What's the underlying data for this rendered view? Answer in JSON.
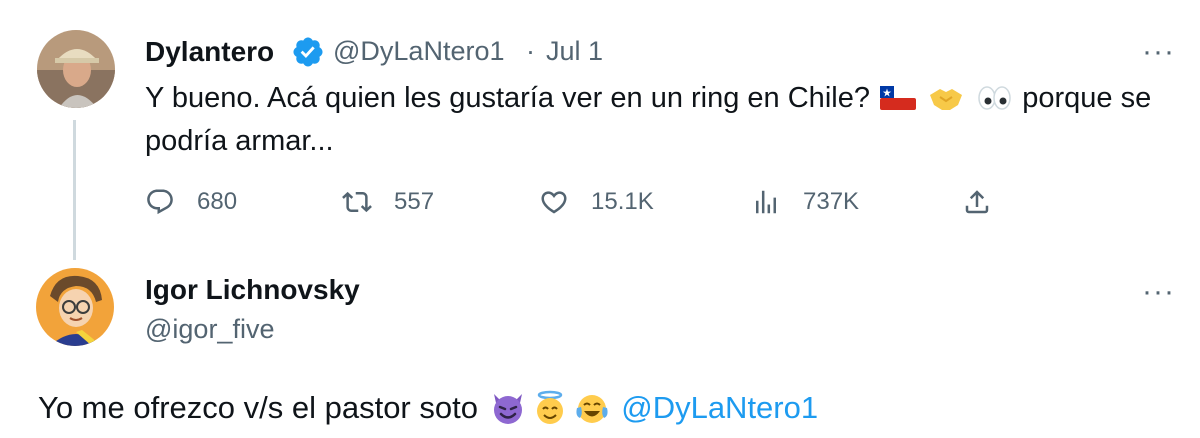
{
  "tweet": {
    "author_name": "Dylantero",
    "handle": "@DyLaNtero1",
    "separator": "·",
    "date": "Jul 1",
    "text_line1": "Y bueno. Acá quien les gustaría ver en un ring en Chile?",
    "text_after_emojis": "porque se",
    "text_line2": "podría armar...",
    "emojis": [
      "chile-flag",
      "handshake",
      "eyes"
    ],
    "metrics": {
      "replies": "680",
      "retweets": "557",
      "likes": "15.1K",
      "views": "737K"
    }
  },
  "reply": {
    "author_name": "Igor Lichnovsky",
    "handle": "@igor_five",
    "text": "Yo me ofrezco v/s el pastor soto",
    "emojis": [
      "smiling-devil",
      "halo-face",
      "tears-of-joy"
    ],
    "mention": "@DyLaNtero1"
  },
  "more_label": "···",
  "colors": {
    "accent": "#1d9bf0",
    "muted": "#536471",
    "thread_line": "#cfd9de"
  }
}
